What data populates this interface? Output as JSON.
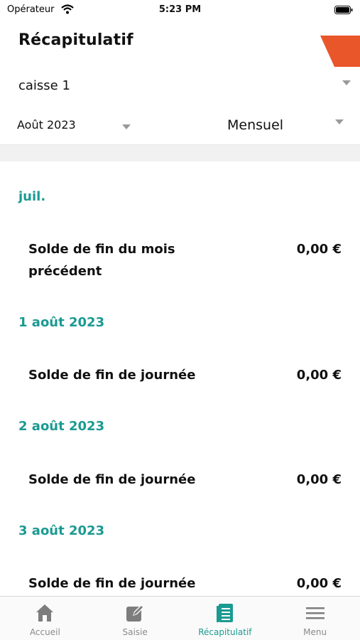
{
  "status_bar": {
    "carrier": "Opérateur",
    "time": "5:23 PM"
  },
  "header": {
    "title": "Récapitulatif"
  },
  "filters": {
    "cash_register": "caisse 1",
    "period": "Août 2023",
    "mode": "Mensuel"
  },
  "list": {
    "sections": [
      {
        "header": "juil.",
        "label_line1": "Solde de fin du mois",
        "label_line2": "précédent",
        "amount": "0,00 €"
      },
      {
        "header": "1 août 2023",
        "label": "Solde de fin de journée",
        "amount": "0,00 €"
      },
      {
        "header": "2 août 2023",
        "label": "Solde de fin de journée",
        "amount": "0,00 €"
      },
      {
        "header": "3 août 2023",
        "label": "Solde de fin de journée",
        "amount": "0,00 €"
      }
    ]
  },
  "tab_bar": {
    "tabs": [
      {
        "label": "Accueil",
        "icon": "home-icon",
        "active": false
      },
      {
        "label": "Saisie",
        "icon": "edit-icon",
        "active": false
      },
      {
        "label": "Récapitulatif",
        "icon": "list-icon",
        "active": true
      },
      {
        "label": "Menu",
        "icon": "hamburger-icon",
        "active": false
      }
    ]
  },
  "colors": {
    "accent": "#1a9a92",
    "corner_tab": "#e8562a",
    "inactive": "#8a8a8a"
  }
}
